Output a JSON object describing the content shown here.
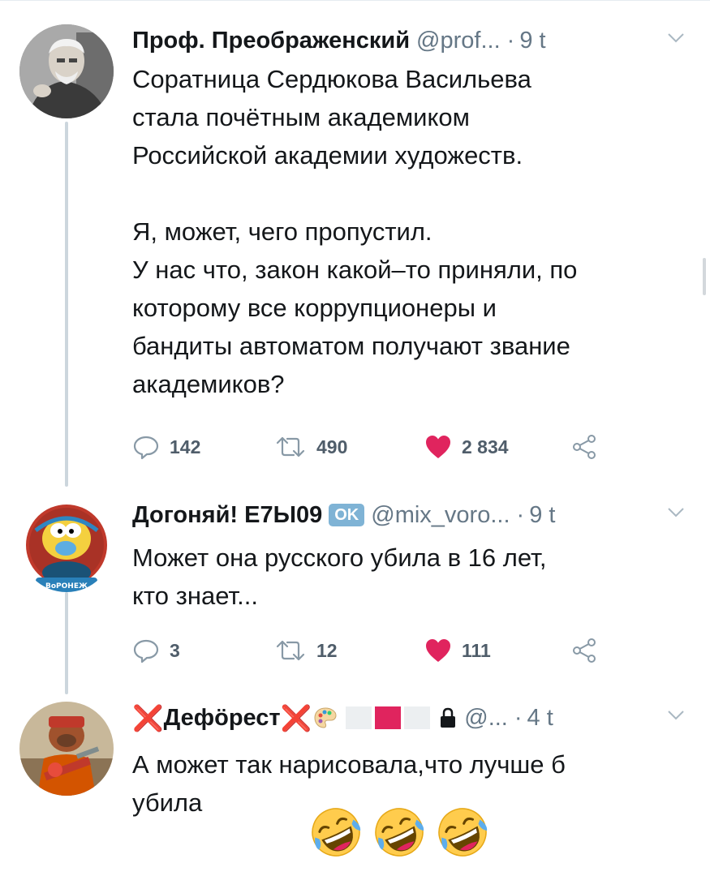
{
  "tweets": [
    {
      "display_name": "Проф. Преображенский",
      "handle": "@prof...",
      "separator": "·",
      "time": "9 t",
      "text_lines": [
        "Соратница Сердюкова Васильева",
        "стала почётным академиком",
        "Российской академии художеств.",
        "",
        "Я, может, чего пропустил.",
        "У нас что, закон какой–то приняли, по",
        "которому все коррупционеры и",
        "бандиты автоматом получают звание",
        "академиков?"
      ],
      "reply_count": "142",
      "retweet_count": "490",
      "like_count": "2 834"
    },
    {
      "display_name": "Догоняй! Е7Ы09",
      "badge": "OK",
      "handle": "@mix_voro...",
      "separator": "·",
      "time": "9 t",
      "avatar_caption": "ВоРОНЕЖ",
      "text_lines": [
        "Может она русского убила в 16 лет,",
        "кто знает..."
      ],
      "reply_count": "3",
      "retweet_count": "12",
      "like_count": "111"
    },
    {
      "display_name": "Дефӧрест",
      "name_prefix": "❌",
      "name_suffix": "❌",
      "handle": "@...",
      "separator": "·",
      "time": "4 t",
      "text_lines": [
        "А может так нарисовала,что лучше б",
        "убила"
      ],
      "emojis": [
        "rolling-on-floor-laughing",
        "rolling-on-floor-laughing",
        "rolling-on-floor-laughing"
      ]
    }
  ],
  "colors": {
    "text": "#14171a",
    "secondary": "#657786",
    "like": "#e0245e",
    "thread_line": "#ccd6dd",
    "ok_badge": "#7fb3d5"
  },
  "icons": {
    "reply": "reply-icon",
    "retweet": "retweet-icon",
    "like": "heart-icon",
    "share": "share-icon",
    "caret": "chevron-down-icon"
  }
}
